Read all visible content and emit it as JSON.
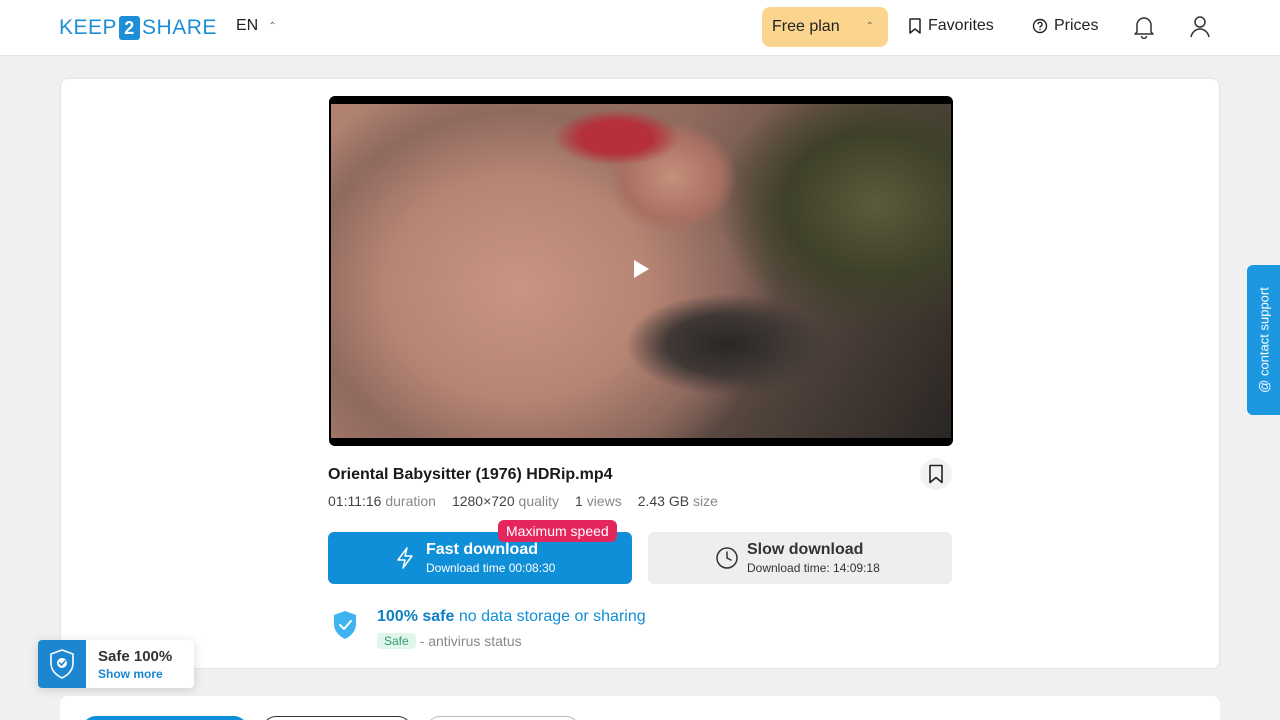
{
  "header": {
    "logo_left": "KEEP",
    "logo_mid": "2",
    "logo_right": "SHARE",
    "lang": "EN",
    "plan": "Free plan",
    "favorites": "Favorites",
    "prices": "Prices"
  },
  "file": {
    "name": "Oriental Babysitter (1976) HDRip.mp4",
    "duration": "01:11:16",
    "duration_label": "duration",
    "quality": "1280×720",
    "quality_label": "quality",
    "views": "1",
    "views_label": "views",
    "size": "2.43 GB",
    "size_label": "size"
  },
  "download": {
    "fast_label": "Fast download",
    "fast_sub": "Download time 00:08:30",
    "max_speed": "Maximum speed",
    "slow_label": "Slow download",
    "slow_sub": "Download time: 14:09:18"
  },
  "safety": {
    "bold": "100% safe",
    "normal": "no data storage or sharing",
    "tag": "Safe",
    "status": "- antivirus status"
  },
  "support": "@ contact support",
  "badge": {
    "title": "Safe 100%",
    "link": "Show more"
  },
  "colors": {
    "accent": "#0f8fd8",
    "plan_bg": "#fbd58d",
    "max_speed": "#e5265d"
  }
}
